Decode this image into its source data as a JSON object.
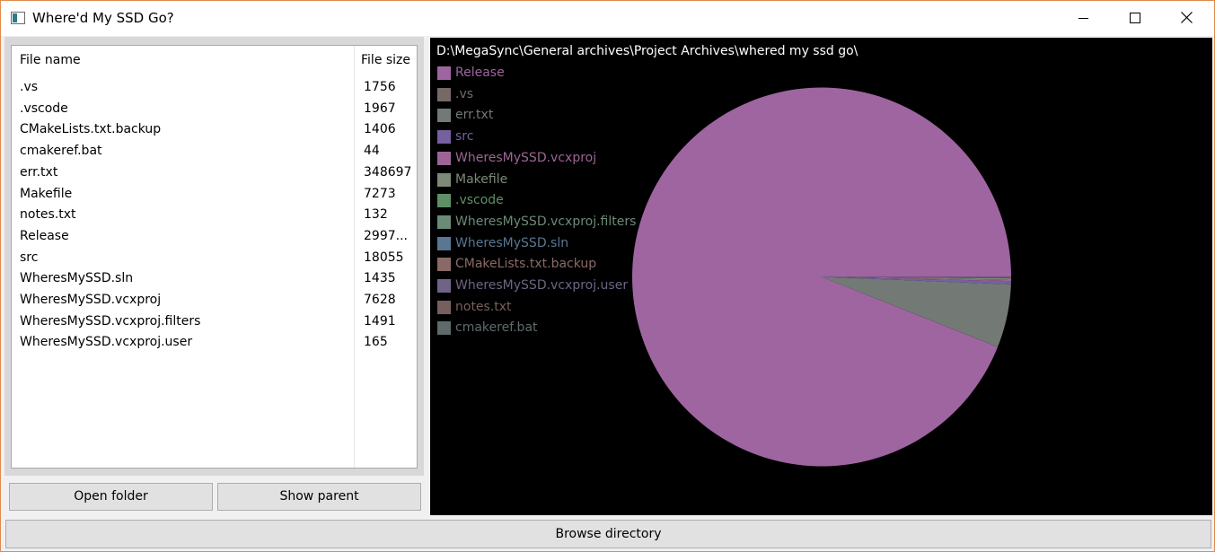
{
  "window": {
    "title": "Where'd My SSD Go?"
  },
  "file_list": {
    "columns": [
      "File name",
      "File size"
    ],
    "rows": [
      {
        "name": ".vs",
        "size": "1756"
      },
      {
        "name": ".vscode",
        "size": "1967"
      },
      {
        "name": "CMakeLists.txt.backup",
        "size": "1406"
      },
      {
        "name": "cmakeref.bat",
        "size": "44"
      },
      {
        "name": "err.txt",
        "size": "348697"
      },
      {
        "name": "Makefile",
        "size": "7273"
      },
      {
        "name": "notes.txt",
        "size": "132"
      },
      {
        "name": "Release",
        "size": "2997..."
      },
      {
        "name": "src",
        "size": "18055"
      },
      {
        "name": "WheresMySSD.sln",
        "size": "1435"
      },
      {
        "name": "WheresMySSD.vcxproj",
        "size": "7628"
      },
      {
        "name": "WheresMySSD.vcxproj.filters",
        "size": "1491"
      },
      {
        "name": "WheresMySSD.vcxproj.user",
        "size": "165"
      }
    ]
  },
  "buttons": {
    "open_folder": "Open folder",
    "show_parent": "Show parent",
    "browse_directory": "Browse directory"
  },
  "chart_data": {
    "type": "pie",
    "path": "D:\\MegaSync\\General archives\\Project Archives\\whered my ssd go\\",
    "slices": [
      {
        "label": "Release",
        "color": "#9f65a0",
        "fraction": 0.9386
      },
      {
        "label": ".vs",
        "color": "#756a66",
        "fraction": 0.0001
      },
      {
        "label": "err.txt",
        "color": "#737a76",
        "fraction": 0.0538
      },
      {
        "label": "src",
        "color": "#7660a0",
        "fraction": 0.0028
      },
      {
        "label": "WheresMySSD.vcxproj",
        "color": "#9d6596",
        "fraction": 0.0012
      },
      {
        "label": "Makefile",
        "color": "#7d8a78",
        "fraction": 0.0011
      },
      {
        "label": ".vscode",
        "color": "#5f8f66",
        "fraction": 0.0003
      },
      {
        "label": "WheresMySSD.vcxproj.filters",
        "color": "#6b8a78",
        "fraction": 0.0002
      },
      {
        "label": "WheresMySSD.sln",
        "color": "#597692",
        "fraction": 0.0002
      },
      {
        "label": "CMakeLists.txt.backup",
        "color": "#8a6a66",
        "fraction": 0.0002
      },
      {
        "label": "WheresMySSD.vcxproj.user",
        "color": "#6f6485",
        "fraction": 0.0001
      },
      {
        "label": "notes.txt",
        "color": "#76605e",
        "fraction": 0.0001
      },
      {
        "label": "cmakeref.bat",
        "color": "#5f6a6b",
        "fraction": 0.0001
      }
    ]
  }
}
